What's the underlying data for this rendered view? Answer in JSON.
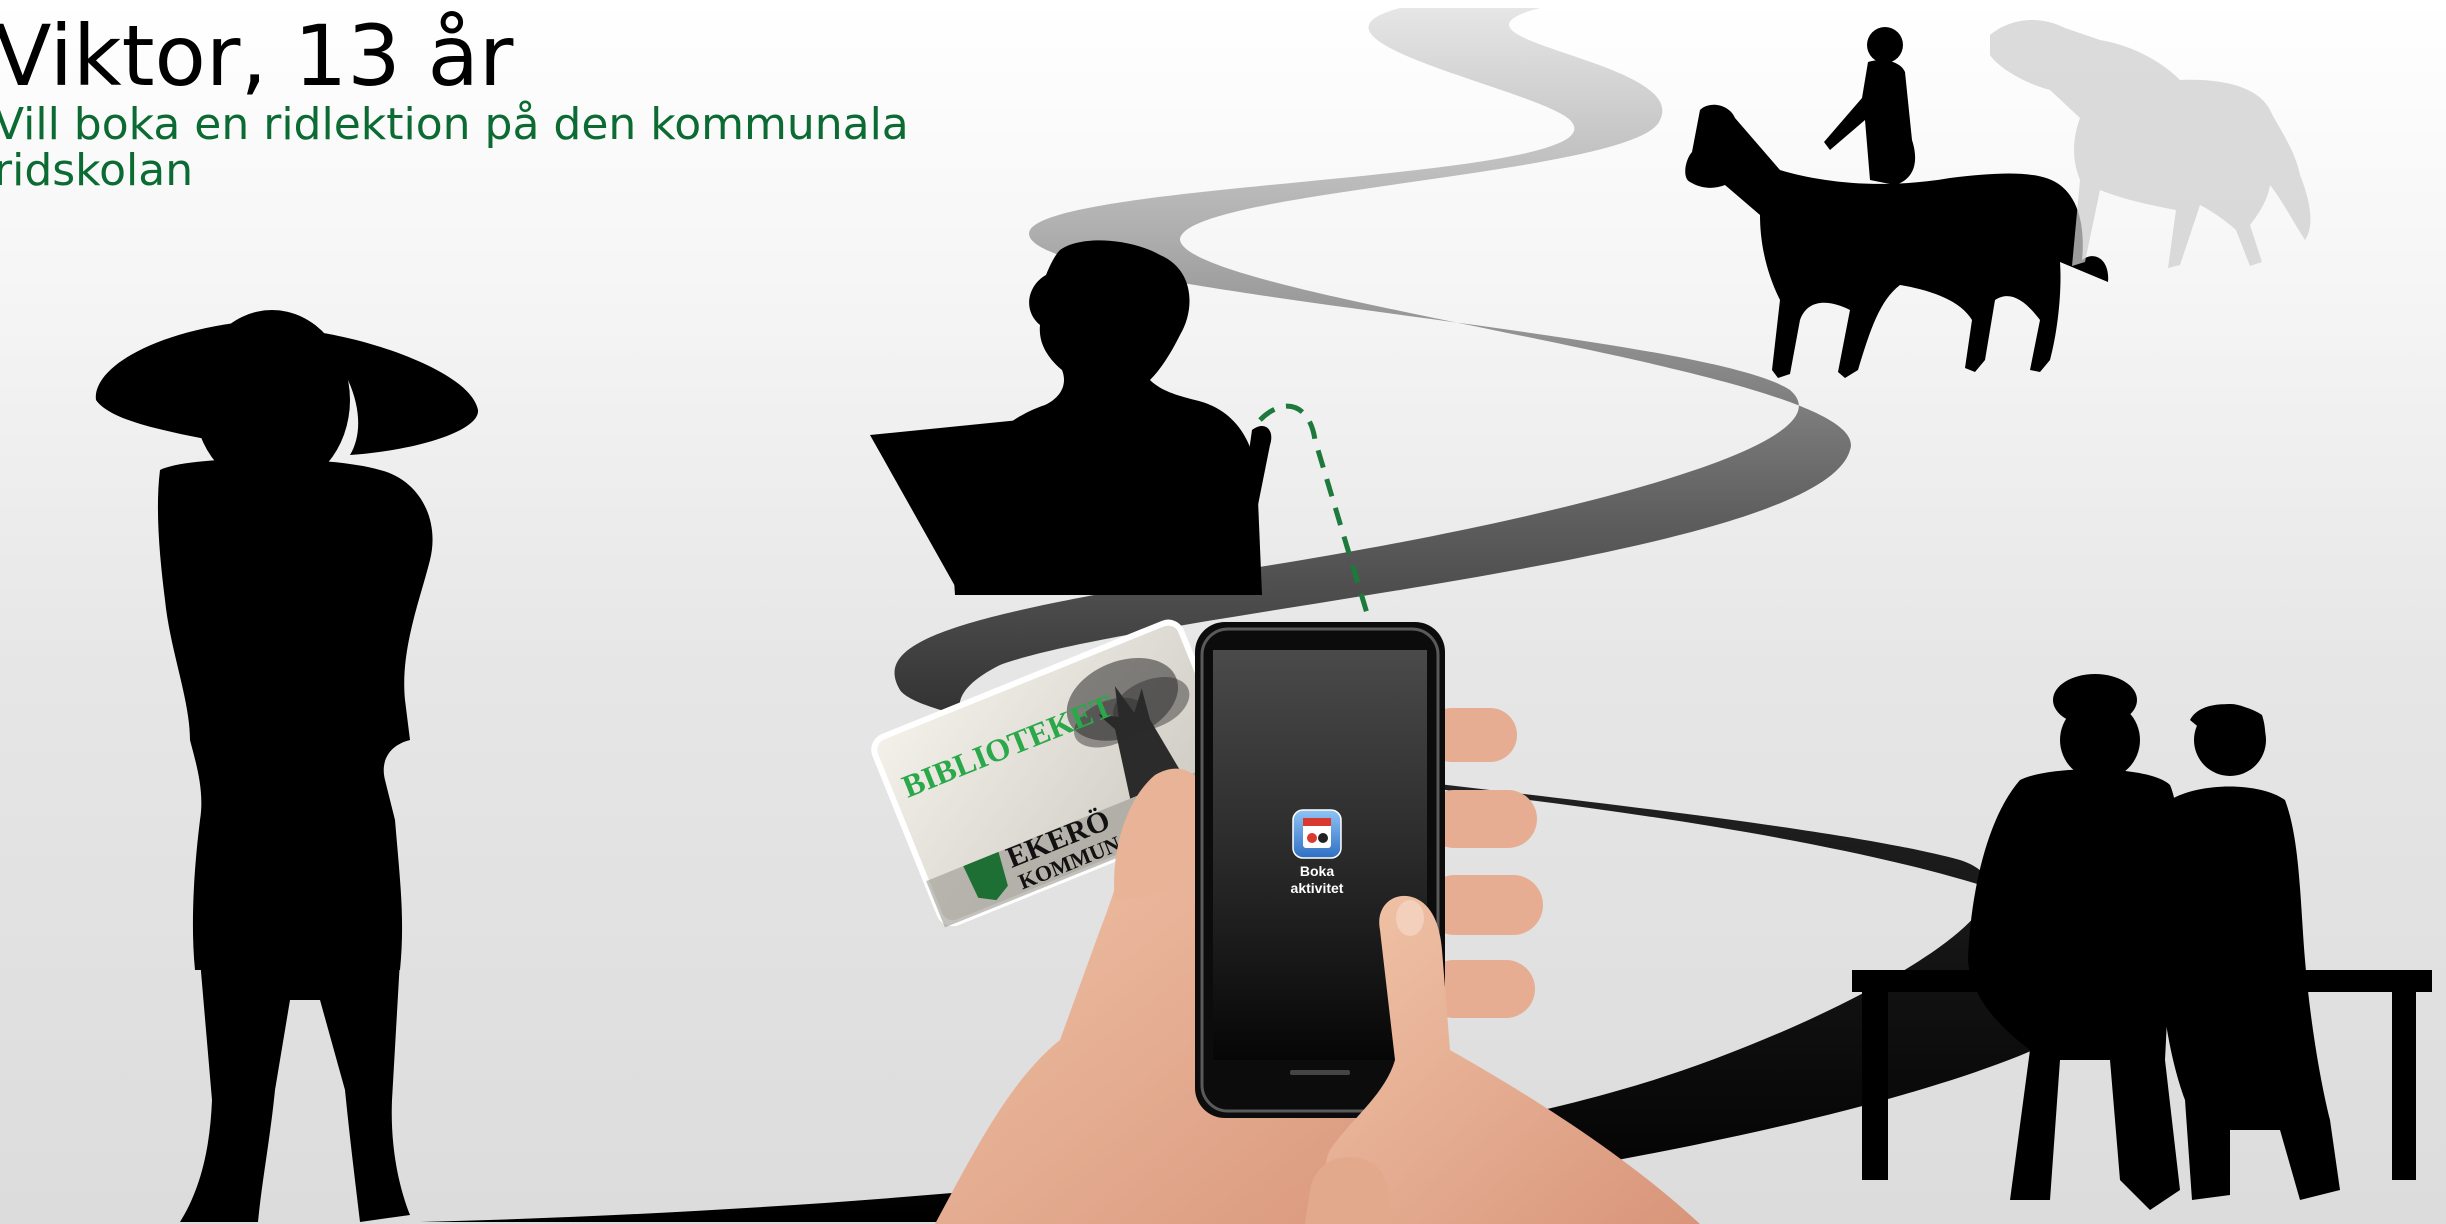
{
  "header": {
    "title": "Viktor, 13 år",
    "subtitle": "Vill boka en ridlektion på den kommunala ridskolan"
  },
  "library_card": {
    "brand": "BIBLIOTEKET",
    "issuer_line1": "EKERÖ",
    "issuer_line2": "KOMMUN"
  },
  "phone": {
    "app_icon": "calendar-app-icon",
    "app_label_line1": "Boka",
    "app_label_line2": "aktivitet"
  },
  "colors": {
    "subtitle": "#0c6b33",
    "card_text": "#2aa84a",
    "dashed_path": "#1d7a3c",
    "app_icon": "#3a7fd0",
    "silhouette": "#000000"
  }
}
